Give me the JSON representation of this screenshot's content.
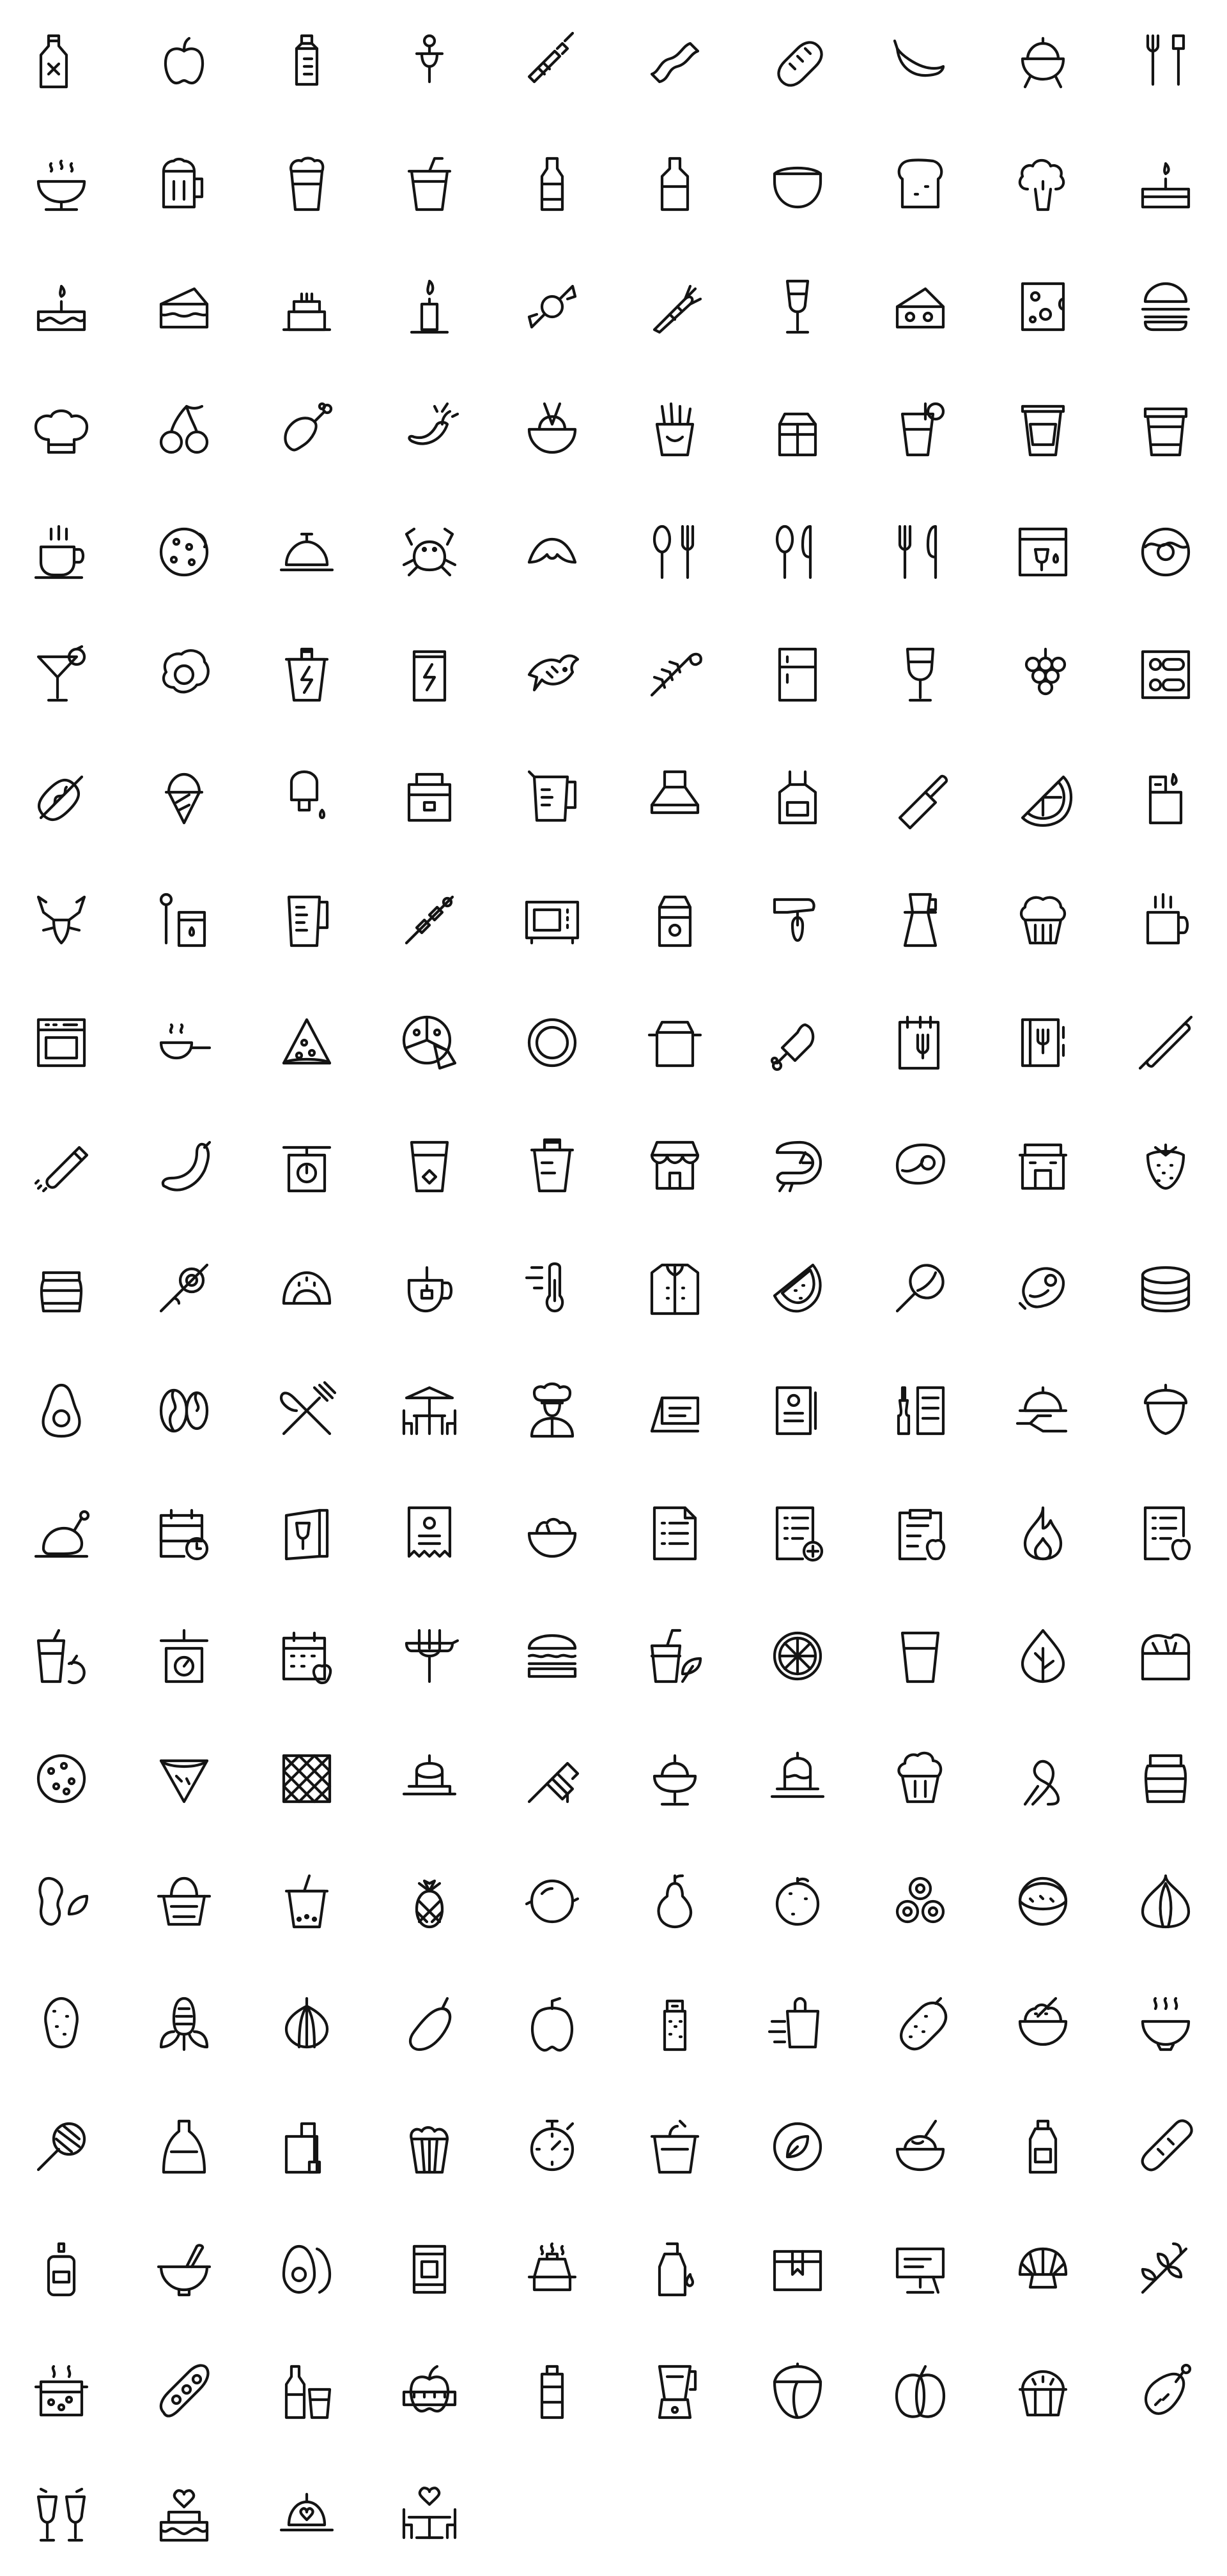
{
  "sheet": {
    "background": "#ffffff",
    "stroke_color": "#141414",
    "columns": 10,
    "icons": [
      "liquor-bottle-icon",
      "apple-icon",
      "baby-bottle-icon",
      "pacifier-icon",
      "baby-bottle-side-icon",
      "bacon-icon",
      "baguette-icon",
      "banana-icon",
      "barbecue-grill-icon",
      "barbecue-tools-icon",
      "grill-icon",
      "beer-mug-icon",
      "beer-glass-icon",
      "drink-cup-icon",
      "beer-bottle-icon",
      "bottle-icon",
      "bowl-icon",
      "bread-toast-icon",
      "broccoli-icon",
      "birthday-cake-slice-icon",
      "birthday-cake-icon",
      "cake-slice-icon",
      "layer-cake-icon",
      "candle-icon",
      "candy-icon",
      "carrot-icon",
      "champagne-glass-icon",
      "cheese-icon",
      "swiss-cheese-icon",
      "hamburger-icon",
      "chef-hat-icon",
      "cherries-icon",
      "chicken-leg-icon",
      "hot-chili-icon",
      "noodle-bowl-icon",
      "french-fries-icon",
      "chocolate-bar-icon",
      "cocktail-icon",
      "coffee-to-go-icon",
      "coffee-cup-icon",
      "hot-coffee-cup-icon",
      "cookie-icon",
      "food-cloche-icon",
      "crab-icon",
      "croissant-icon",
      "spoon-fork-icon",
      "spoon-knife-icon",
      "fork-knife-icon",
      "wine-list-icon",
      "donut-icon",
      "martini-icon",
      "fried-egg-icon",
      "energy-drink-cup-icon",
      "energy-drink-can-icon",
      "fish-icon",
      "fish-bone-icon",
      "refrigerator-icon",
      "wine-glass-icon",
      "grapes-icon",
      "food-tray-icon",
      "hot-dog-icon",
      "ice-cream-cone-icon",
      "popsicle-icon",
      "lunch-box-icon",
      "measuring-jug-icon",
      "kitchen-hood-icon",
      "apron-icon",
      "kitchen-knife-icon",
      "lemon-slice-icon",
      "lighter-icon",
      "lobster-icon",
      "matches-icon",
      "measuring-cup-icon",
      "kebab-icon",
      "microwave-icon",
      "milk-carton-icon",
      "hand-mixer-icon",
      "moka-pot-icon",
      "muffin-icon",
      "hot-mug-icon",
      "oven-icon",
      "frying-pan-icon",
      "pizza-slice-icon",
      "pizza-icon",
      "plate-icon",
      "cooking-pot-icon",
      "turkey-leg-icon",
      "restaurant-menu-icon",
      "recipe-book-icon",
      "rolling-pin-icon",
      "salt-shaker-icon",
      "sausage-icon",
      "kitchen-scale-icon",
      "water-glass-icon",
      "blender-cup-icon",
      "shop-icon",
      "shrimp-icon",
      "steak-icon",
      "restaurant-icon",
      "strawberry-icon",
      "jam-jar-icon",
      "sushi-roll-icon",
      "taco-icon",
      "tea-cup-icon",
      "thermometer-icon",
      "chef-jacket-icon",
      "watermelon-icon",
      "whisk-icon",
      "meat-icon",
      "pancakes-icon",
      "avocado-icon",
      "coffee-beans-icon",
      "crossed-utensils-icon",
      "outdoor-table-icon",
      "chef-icon",
      "table-sign-icon",
      "menu-card-icon",
      "wine-menu-icon",
      "serving-hand-icon",
      "acorn-icon",
      "roast-chicken-icon",
      "meal-schedule-icon",
      "wine-card-icon",
      "receipt-icon",
      "salad-bowl-icon",
      "recipe-document-icon",
      "add-recipe-icon",
      "grocery-clipboard-icon",
      "fire-icon",
      "nutrition-document-icon",
      "juice-glass-icon",
      "weighing-scale-icon",
      "diet-calendar-icon",
      "fork-sausage-icon",
      "sandwich-icon",
      "smoothie-icon",
      "cucumber-slice-icon",
      "glass-icon",
      "leaf-icon",
      "bread-loaf-icon",
      "biscuit-icon",
      "pie-slice-icon",
      "waffle-icon",
      "pudding-icon",
      "honey-dipper-icon",
      "sundae-icon",
      "jelly-icon",
      "cupcake-icon",
      "pretzel-icon",
      "jar-icon",
      "peanut-icon",
      "picnic-basket-icon",
      "bubble-tea-icon",
      "pineapple-icon",
      "lemon-icon",
      "pear-icon",
      "orange-icon",
      "peas-icon",
      "coconut-icon",
      "garlic-icon",
      "potato-icon",
      "corn-icon",
      "onion-icon",
      "eggplant-icon",
      "bell-pepper-icon",
      "pepper-shaker-icon",
      "fast-delivery-icon",
      "pickle-icon",
      "rice-bowl-icon",
      "soup-bowl-icon",
      "lollipop-icon",
      "sake-bottle-icon",
      "tea-bag-icon",
      "popcorn-icon",
      "kitchen-timer-icon",
      "yogurt-icon",
      "vegan-icon",
      "pasta-bowl-icon",
      "sauce-bottle-icon",
      "bread-stick-icon",
      "ketchup-bottle-icon",
      "mortar-pestle-icon",
      "egg-icon",
      "canned-food-icon",
      "takeaway-box-icon",
      "oil-bottle-icon",
      "packaging-box-icon",
      "signboard-icon",
      "scallop-shell-icon",
      "olive-branch-icon",
      "boiling-pot-icon",
      "pea-pod-icon",
      "bottle-glass-icon",
      "apple-tape-measure-icon",
      "water-bottle-icon",
      "juicer-blender-icon",
      "hazelnut-icon",
      "pumpkin-icon",
      "pie-icon",
      "roast-turkey-icon",
      "cheers-icon",
      "wedding-cake-icon",
      "romantic-dinner-icon",
      "date-table-icon"
    ]
  }
}
